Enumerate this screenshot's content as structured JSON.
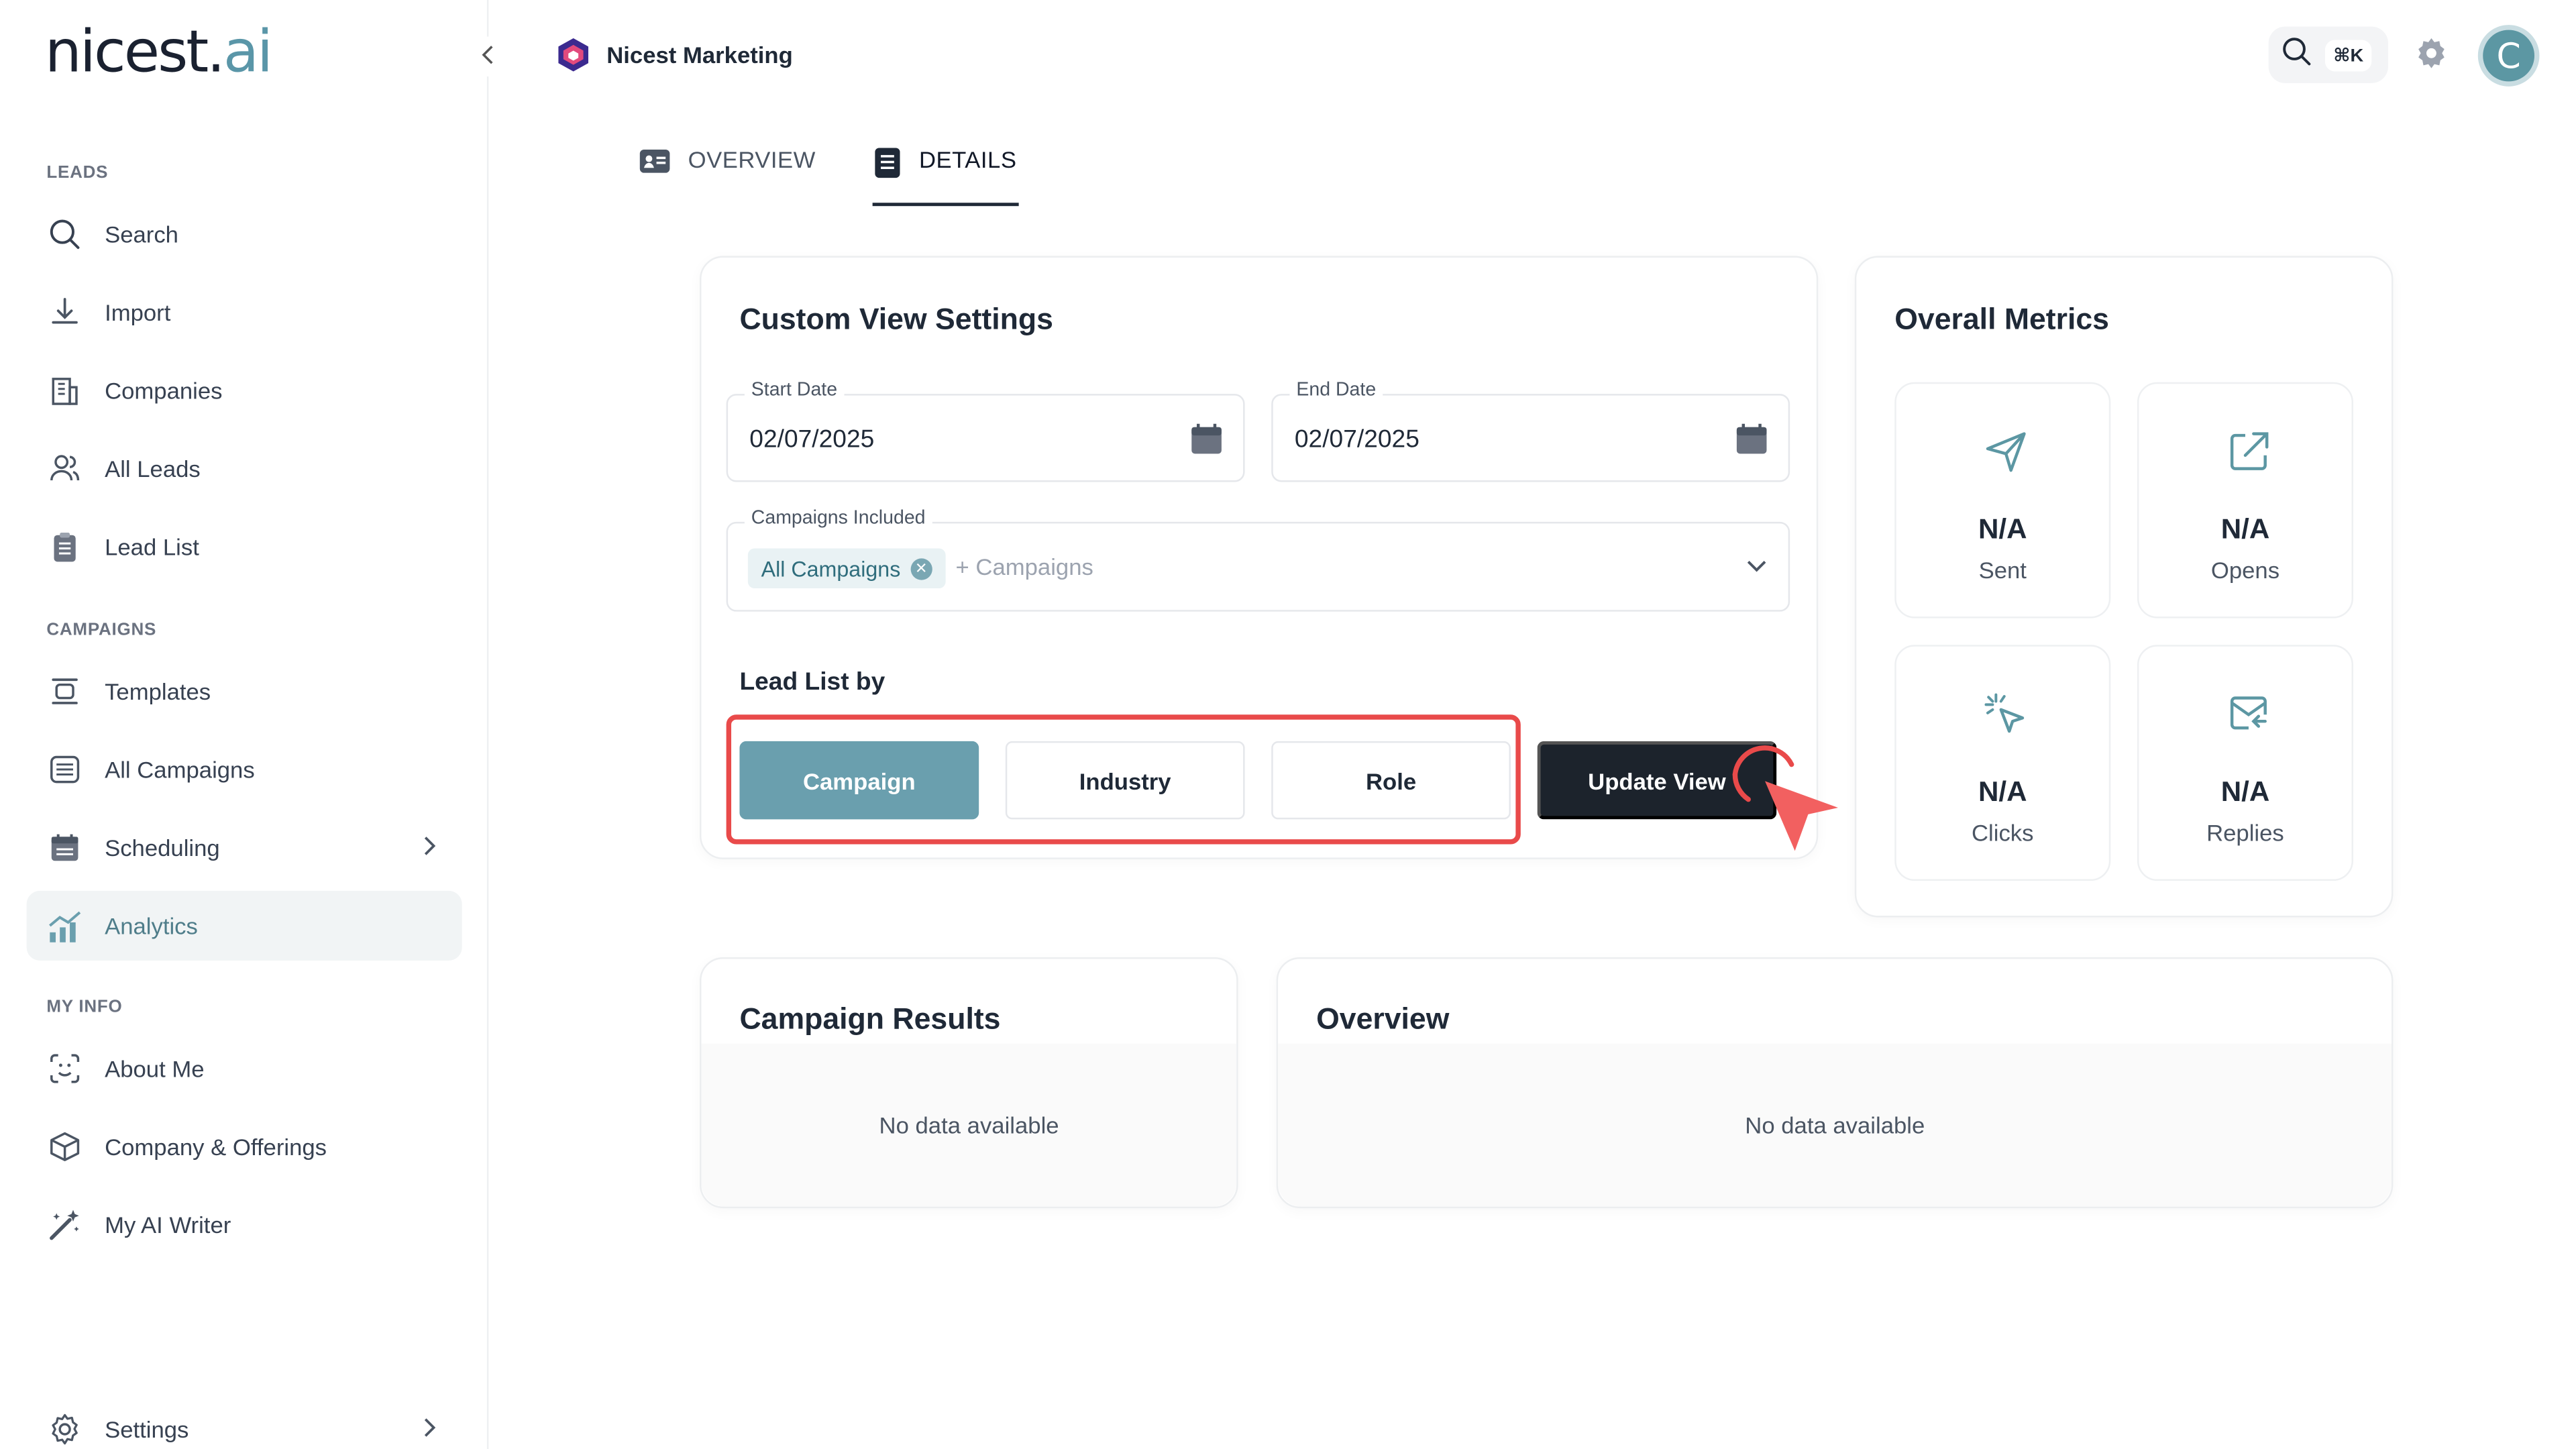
{
  "logo": {
    "main": "nicest.",
    "accent": "ai"
  },
  "sidebar": {
    "sections": {
      "leads": "LEADS",
      "campaigns": "CAMPAIGNS",
      "myinfo": "MY INFO"
    },
    "items": {
      "search": "Search",
      "import": "Import",
      "companies": "Companies",
      "all_leads": "All Leads",
      "lead_list": "Lead List",
      "templates": "Templates",
      "all_campaigns": "All Campaigns",
      "scheduling": "Scheduling",
      "analytics": "Analytics",
      "about_me": "About Me",
      "company_offerings": "Company & Offerings",
      "ai_writer": "My AI Writer",
      "settings": "Settings"
    },
    "active": "analytics"
  },
  "header": {
    "workspace": "Nicest Marketing",
    "shortcut": "⌘K",
    "avatar_initial": "C",
    "accent": "#5c97a3"
  },
  "tabs": {
    "overview": "OVERVIEW",
    "details": "DETAILS",
    "active": "details"
  },
  "custom_view": {
    "title": "Custom View Settings",
    "start_date_label": "Start Date",
    "start_date": "02/07/2025",
    "end_date_label": "End Date",
    "end_date": "02/07/2025",
    "campaigns_label": "Campaigns Included",
    "campaign_chip": "All Campaigns",
    "campaigns_placeholder": "+ Campaigns",
    "lead_list_title": "Lead List by",
    "group_options": {
      "campaign": "Campaign",
      "industry": "Industry",
      "role": "Role"
    },
    "group_selected": "campaign",
    "update_button": "Update View"
  },
  "metrics": {
    "title": "Overall Metrics",
    "sent": {
      "value": "N/A",
      "label": "Sent"
    },
    "opens": {
      "value": "N/A",
      "label": "Opens"
    },
    "clicks": {
      "value": "N/A",
      "label": "Clicks"
    },
    "replies": {
      "value": "N/A",
      "label": "Replies"
    }
  },
  "campaign_results": {
    "title": "Campaign Results",
    "empty": "No data available"
  },
  "overview": {
    "title": "Overview",
    "empty": "No data available"
  }
}
